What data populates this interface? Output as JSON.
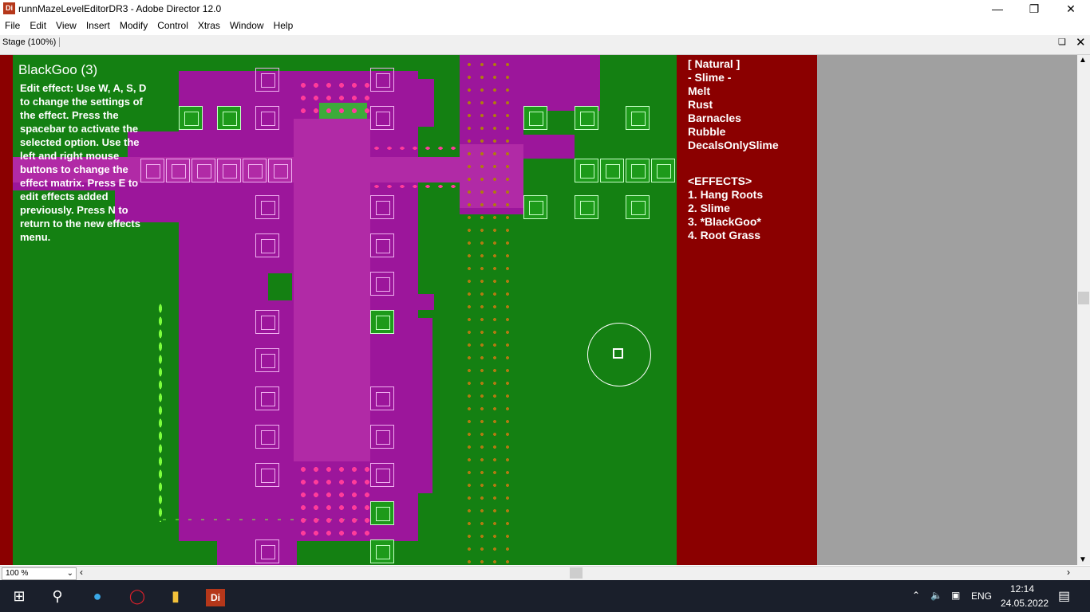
{
  "window": {
    "icon_label": "Di",
    "title": "runnMazeLevelEditorDR3 - Adobe Director 12.0"
  },
  "menu": [
    "File",
    "Edit",
    "View",
    "Insert",
    "Modify",
    "Control",
    "Xtras",
    "Window",
    "Help"
  ],
  "stage_tab": "Stage (100%)",
  "editor": {
    "effect_title": "BlackGoo (3)",
    "help_text": "Edit effect: Use W, A, S, D to change the settings of the effect. Press the spacebar to activate the selected option. Use the left and right mouse buttons to change the effect matrix. Press E to edit effects added previously. Press N to return to the new effects menu."
  },
  "panel": {
    "category": "[ Natural ]",
    "options": [
      "- Slime -",
      "Melt",
      "Rust",
      "Barnacles",
      "Rubble",
      "DecalsOnlySlime"
    ],
    "effects_header": "<EFFECTS>",
    "effects": [
      "1. Hang Roots",
      "2. Slime",
      "3. *BlackGoo*",
      "4. Root Grass"
    ]
  },
  "statusbar": {
    "zoom": "100 %"
  },
  "taskbar": {
    "director_label": "Di",
    "lang": "ENG",
    "time": "12:14",
    "date": "24.05.2022"
  },
  "colors": {
    "canvas_green": "#148012",
    "goo_purple": "#9c169b",
    "panel_red": "#8b0000"
  }
}
